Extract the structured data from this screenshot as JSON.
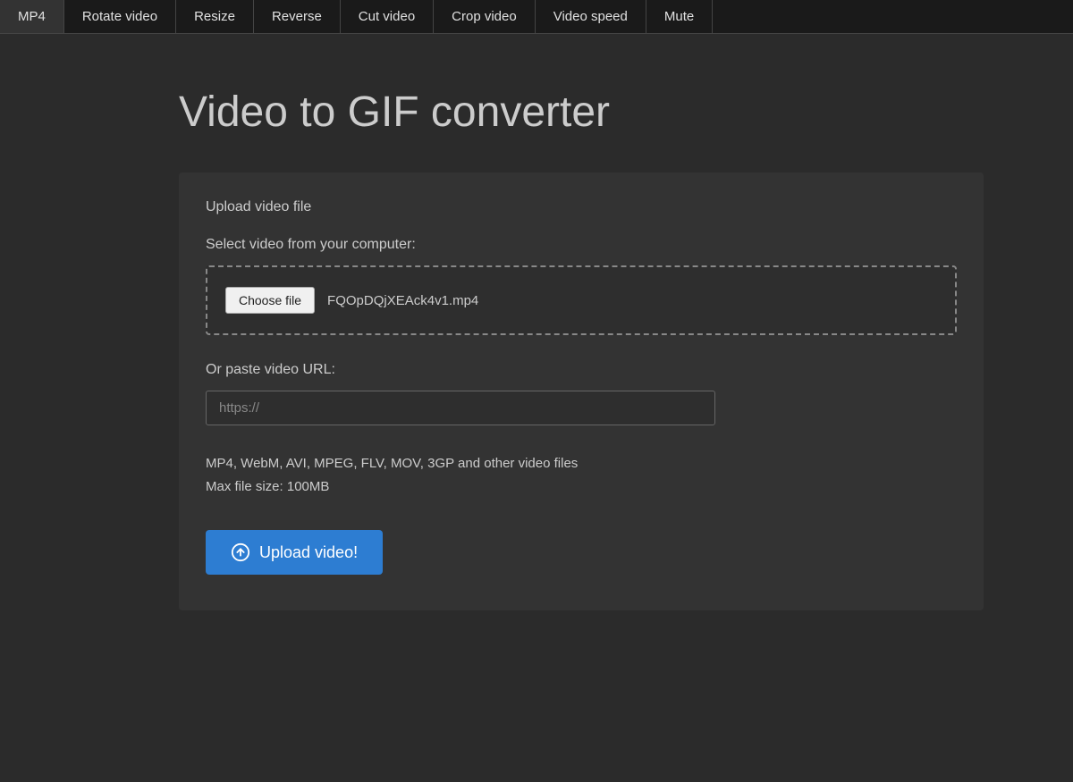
{
  "nav": {
    "items": [
      {
        "label": "MP4",
        "id": "nav-mp4"
      },
      {
        "label": "Rotate video",
        "id": "nav-rotate"
      },
      {
        "label": "Resize",
        "id": "nav-resize"
      },
      {
        "label": "Reverse",
        "id": "nav-reverse"
      },
      {
        "label": "Cut video",
        "id": "nav-cut"
      },
      {
        "label": "Crop video",
        "id": "nav-crop"
      },
      {
        "label": "Video speed",
        "id": "nav-speed"
      },
      {
        "label": "Mute",
        "id": "nav-mute"
      }
    ]
  },
  "page": {
    "title": "Video to GIF converter"
  },
  "card": {
    "header": "Upload video file",
    "file_section_label": "Select video from your computer:",
    "choose_file_btn": "Choose file",
    "file_name": "FQOpDQjXEAck4v1.mp4",
    "url_section_label": "Or paste video URL:",
    "url_placeholder": "https://",
    "info_line1": "MP4, WebM, AVI, MPEG, FLV, MOV, 3GP and other video files",
    "info_line2": "Max file size: 100MB",
    "upload_btn_label": "Upload video!"
  }
}
